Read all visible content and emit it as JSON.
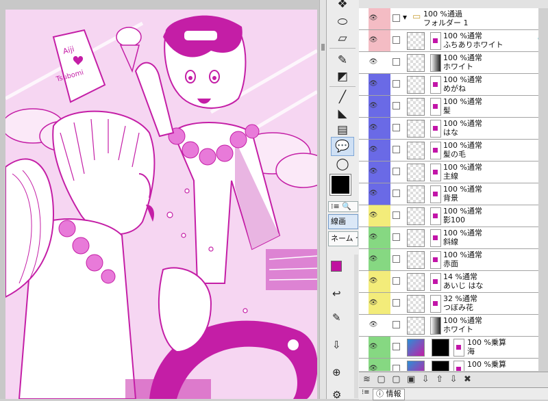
{
  "tools": {
    "color_main": "#000000",
    "color_accent": "#c0129f",
    "tabs": [
      {
        "label": "線画"
      },
      {
        "label": "ネーム セ"
      }
    ]
  },
  "artwork": {
    "sign_top": "Aiji",
    "sign_bottom": "Tsubomi",
    "accent": "#c41ea6",
    "bg": "#f6d6f2"
  },
  "layers": {
    "rows": [
      {
        "opacity": "100 %通過",
        "name": "フォルダー 1",
        "color": "#f4bcc4",
        "type": "folder"
      },
      {
        "opacity": "100 %通常",
        "name": "ふちありホワイト",
        "color": "#f4bcc4",
        "type": "masked"
      },
      {
        "opacity": "100 %通常",
        "name": "ホワイト",
        "color": "#ffffff",
        "type": "grad"
      },
      {
        "opacity": "100 %通常",
        "name": "めがね",
        "color": "#6a6ae6",
        "type": "mag"
      },
      {
        "opacity": "100 %通常",
        "name": "髪",
        "color": "#6a6ae6",
        "type": "mag"
      },
      {
        "opacity": "100 %通常",
        "name": "はな",
        "color": "#6a6ae6",
        "type": "mag"
      },
      {
        "opacity": "100 %通常",
        "name": "髪の毛",
        "color": "#6a6ae6",
        "type": "mag"
      },
      {
        "opacity": "100 %通常",
        "name": "主線",
        "color": "#6a6ae6",
        "type": "mag"
      },
      {
        "opacity": "100 %通常",
        "name": "背景",
        "color": "#6a6ae6",
        "type": "mag"
      },
      {
        "opacity": "100 %通常",
        "name": "影100",
        "color": "#f3ec7a",
        "type": "mag"
      },
      {
        "opacity": "100 %通常",
        "name": "斜線",
        "color": "#86d882",
        "type": "mag"
      },
      {
        "opacity": "100 %通常",
        "name": "赤面",
        "color": "#86d882",
        "type": "mag"
      },
      {
        "opacity": "14 %通常",
        "name": "あいじ はな",
        "color": "#f3ec7a",
        "type": "mag"
      },
      {
        "opacity": "32 %通常",
        "name": "つぼみ花",
        "color": "#f3ec7a",
        "type": "mag"
      },
      {
        "opacity": "100 %通常",
        "name": "ホワイト",
        "color": "#ffffff",
        "type": "grad"
      },
      {
        "opacity": "100 %乗算",
        "name": "海",
        "color": "#86d882",
        "type": "dark"
      },
      {
        "opacity": "100 %乗算",
        "name": "",
        "color": "#86d882",
        "type": "dark"
      }
    ]
  },
  "info": {
    "tab_label": "情報"
  }
}
